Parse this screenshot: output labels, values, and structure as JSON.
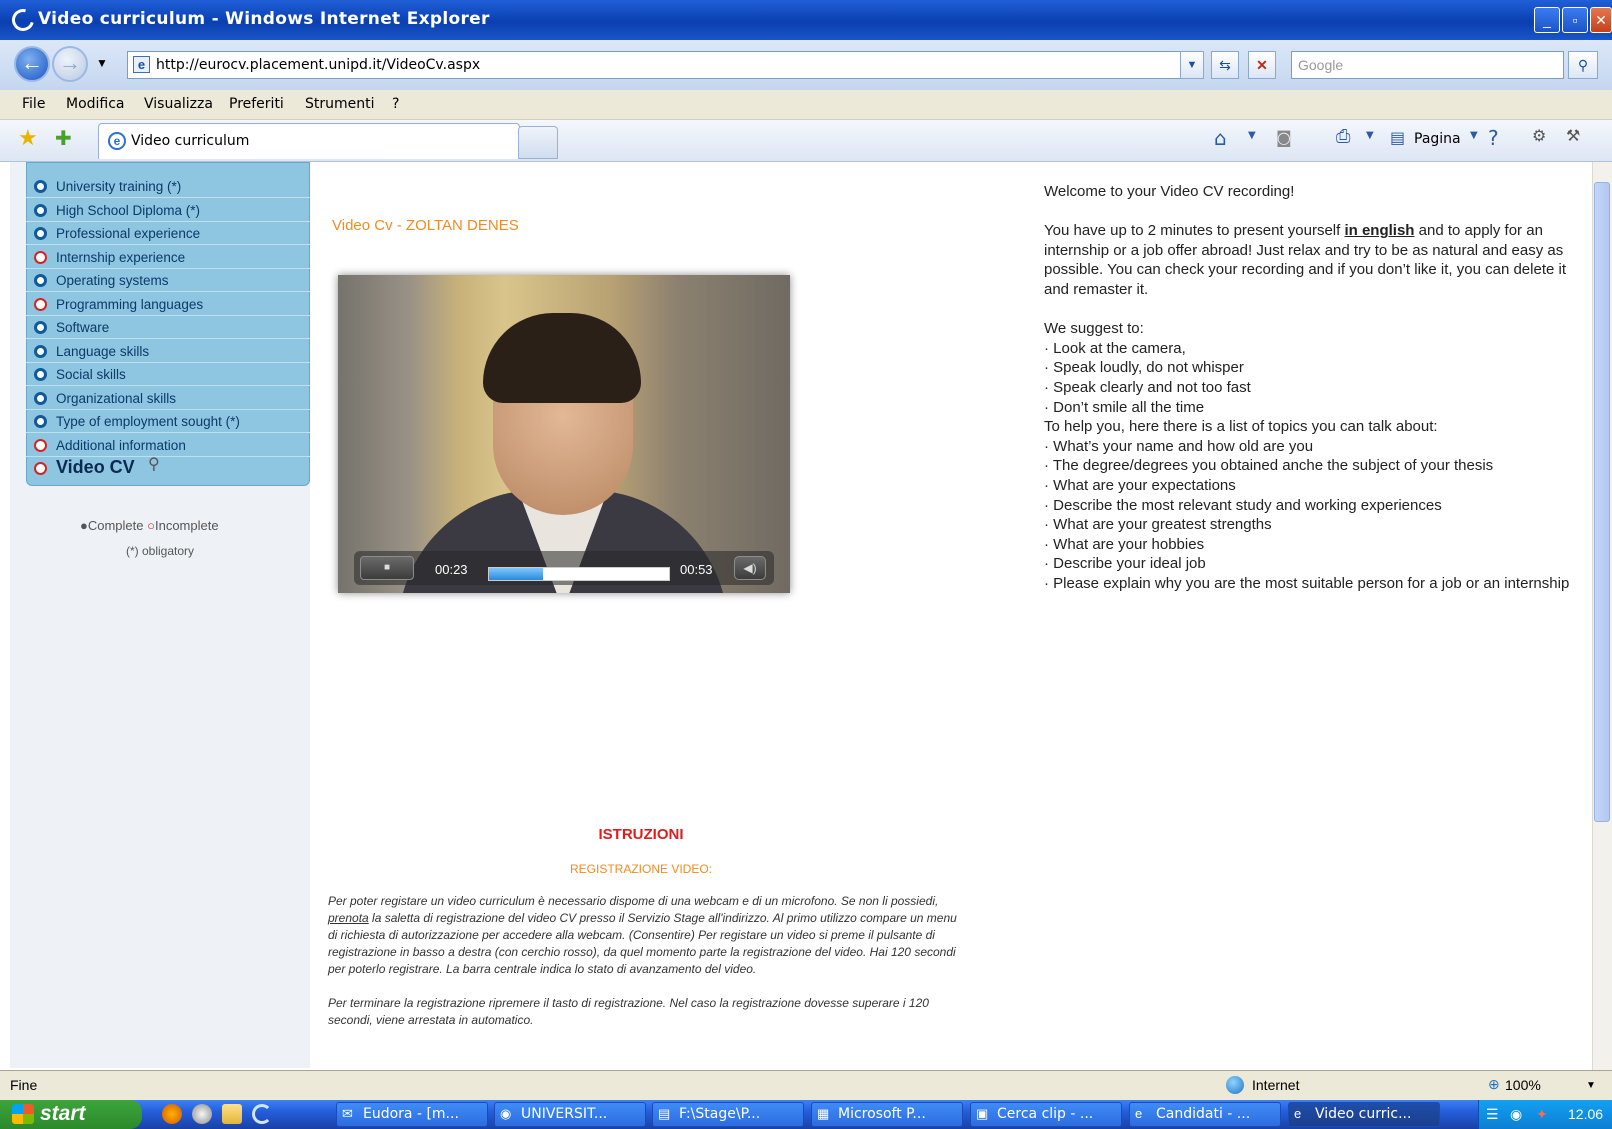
{
  "window": {
    "title": "Video curriculum - Windows Internet Explorer"
  },
  "address": {
    "url": "http://eurocv.placement.unipd.it/VideoCv.aspx",
    "search_placeholder": "Google"
  },
  "menu": [
    "File",
    "Modifica",
    "Visualizza",
    "Preferiti",
    "Strumenti",
    "?"
  ],
  "tab": {
    "label": "Video curriculum"
  },
  "toolbar": {
    "page_label": "Pagina"
  },
  "sidebar": {
    "items": [
      {
        "label": "University training (*)",
        "status": "complete"
      },
      {
        "label": "High School Diploma (*)",
        "status": "complete"
      },
      {
        "label": "Professional experience",
        "status": "complete"
      },
      {
        "label": "Internship experience",
        "status": "incomplete"
      },
      {
        "label": "Operating systems",
        "status": "complete"
      },
      {
        "label": "Programming languages",
        "status": "incomplete"
      },
      {
        "label": "Software",
        "status": "complete"
      },
      {
        "label": "Language skills",
        "status": "complete"
      },
      {
        "label": "Social skills",
        "status": "complete"
      },
      {
        "label": "Organizational skills",
        "status": "complete"
      },
      {
        "label": "Type of employment sought (*)",
        "status": "complete"
      },
      {
        "label": "Additional information",
        "status": "incomplete"
      }
    ],
    "current": "Video CV",
    "legend_complete": "Complete",
    "legend_incomplete": "Incomplete",
    "obligatory": "(*) obligatory"
  },
  "video": {
    "title": "Video Cv - ZOLTAN DENES",
    "current_time": "00:23",
    "total_time": "00:53",
    "progress": 0.3
  },
  "instructions": {
    "welcome": "Welcome to your Video CV recording!",
    "intro_pre": "You have up to 2 minutes to present yourself ",
    "intro_link": "in english",
    "intro_post": " and to apply for an internship or a job offer abroad! Just relax and try to be as natural and easy as possible. You can check your recording and if you don’t like it, you can delete it and remaster it.",
    "suggest_head": "We suggest to:",
    "suggestions": [
      "· Look at the camera,",
      "· Speak loudly, do not whisper",
      "· Speak clearly and not too fast",
      "· Don’t smile all the time"
    ],
    "topics_head": "To help you, here there is a list of topics you can talk about:",
    "topics": [
      "· What’s your name and how old are you",
      "· The degree/degrees you obtained anche the subject of your thesis",
      "· What are your expectations",
      "· Describe the most relevant study and working experiences",
      "· What are your greatest strengths",
      "· What are your hobbies",
      "· Describe your ideal job",
      "· Please explain why you are the most suitable person for a job or an internship"
    ]
  },
  "istruzioni": {
    "heading": "ISTRUZIONI",
    "subheading": "REGISTRAZIONE VIDEO:",
    "p1_pre": "Per poter registare un video curriculum è necessario dispome di una webcam e di un microfono. Se non li possiedi, ",
    "p1_link": "prenota",
    "p1_post": " la saletta di registrazione del video CV presso il Servizio Stage all'indirizzo. Al primo utilizzo compare un menu di richiesta di autorizzazione per accedere alla webcam. (Consentire) Per registare un video si preme il pulsante di registrazione in basso a destra (con cerchio rosso), da quel momento parte la registrazione del video. Hai 120 secondi per poterlo registrare. La barra centrale indica lo stato di avanzamento del video.",
    "p2": "Per terminare la registrazione ripremere il tasto di registrazione. Nel caso la registrazione dovesse superare i 120 secondi, viene arrestata in automatico."
  },
  "status": {
    "text": "Fine",
    "zone": "Internet",
    "zoom": "100%"
  },
  "taskbar": {
    "start": "start",
    "tasks": [
      "Eudora - [m...",
      "UNIVERSIT...",
      "F:\\Stage\\P...",
      "Microsoft P...",
      "Cerca clip - ...",
      "Candidati - ...",
      "Video curric..."
    ],
    "clock": "12.06"
  },
  "colors": {
    "accent_orange": "#f08c22",
    "accent_red": "#e01c1c",
    "nav_blue": "#8ec5e0"
  }
}
